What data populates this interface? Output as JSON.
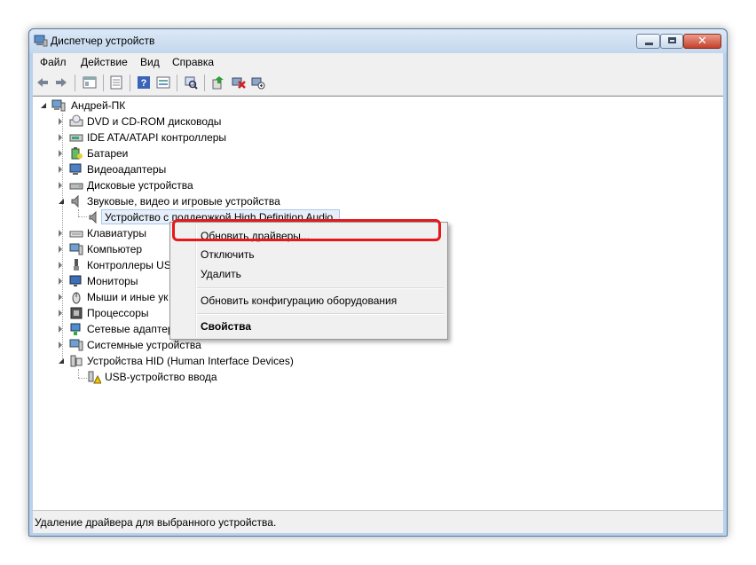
{
  "window": {
    "title": "Диспетчер устройств",
    "close_glyph": "✕"
  },
  "menu": [
    "Файл",
    "Действие",
    "Вид",
    "Справка"
  ],
  "toolbar": {
    "icons": [
      "back-icon",
      "forward-icon",
      "tree-view-icon",
      "properties-icon",
      "help-icon",
      "resources-view-icon",
      "scan-hardware-icon",
      "update-driver-icon",
      "uninstall-icon",
      "enable-device-icon"
    ]
  },
  "tree": {
    "root": "Андрей-ПК",
    "items": [
      "DVD и CD-ROM дисководы",
      "IDE ATA/ATAPI контроллеры",
      "Батареи",
      "Видеоадаптеры",
      "Дисковые устройства",
      "Звуковые, видео и игровые устройства",
      "Устройство с поддержкой High Definition Audio",
      "Клавиатуры",
      "Компьютер",
      "Контроллеры US",
      "Мониторы",
      "Мыши и иные ук",
      "Процессоры",
      "Сетевые адаптер",
      "Системные устройства",
      "Устройства HID (Human Interface Devices)",
      "USB-устройство ввода"
    ]
  },
  "context_menu": {
    "update": "Обновить драйверы...",
    "disable": "Отключить",
    "delete": "Удалить",
    "scan": "Обновить конфигурацию оборудования",
    "properties": "Свойства"
  },
  "status": "Удаление драйвера для выбранного устройства.",
  "colors": {
    "highlight": "#e5181c",
    "selection": "#e7f0fa",
    "frame": "#b9d1ea"
  }
}
